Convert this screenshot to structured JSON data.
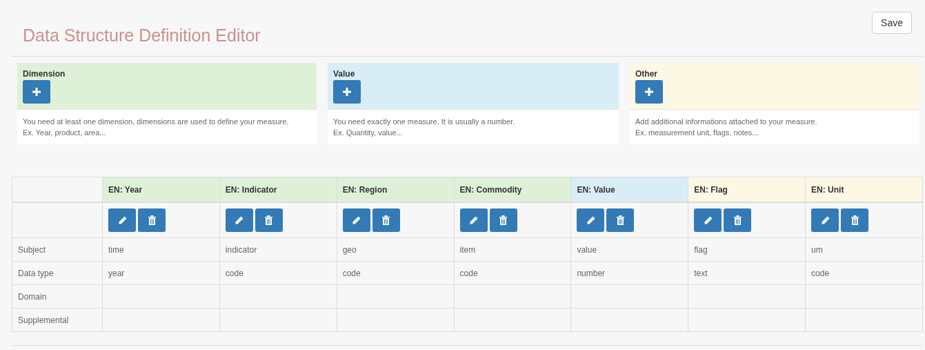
{
  "header": {
    "title": "Data Structure Definition Editor",
    "save_button": "Save"
  },
  "panels": [
    {
      "kind": "dimension",
      "title": "Dimension",
      "lines": [
        "You need at least one dimension, dimensions are used to define your measure.",
        "Ex. Year, product, area..."
      ]
    },
    {
      "kind": "value",
      "title": "Value",
      "lines": [
        "You need exactly one measure. It is usually a number.",
        "Ex. Quantity, value..."
      ]
    },
    {
      "kind": "other",
      "title": "Other",
      "lines": [
        "Add additional informations attached to your measure.",
        "Ex. measurement unit, flags, notes..."
      ]
    }
  ],
  "table": {
    "row_labels": [
      "Subject",
      "Data type",
      "Domain",
      "Supplemental"
    ],
    "columns": [
      {
        "kind": "dimension",
        "header": "EN: Year",
        "cells": [
          "time",
          "year"
        ]
      },
      {
        "kind": "dimension",
        "header": "EN: Indicator",
        "cells": [
          "indicator",
          "code"
        ]
      },
      {
        "kind": "dimension",
        "header": "EN: Region",
        "cells": [
          "geo",
          "code"
        ]
      },
      {
        "kind": "dimension",
        "header": "EN: Commodity",
        "cells": [
          "item",
          "code"
        ]
      },
      {
        "kind": "value",
        "header": "EN: Value",
        "cells": [
          "value",
          "number"
        ]
      },
      {
        "kind": "other",
        "header": "EN: Flag",
        "cells": [
          "flag",
          "text"
        ]
      },
      {
        "kind": "other",
        "header": "EN: Unit",
        "cells": [
          "um",
          "code"
        ]
      }
    ]
  }
}
